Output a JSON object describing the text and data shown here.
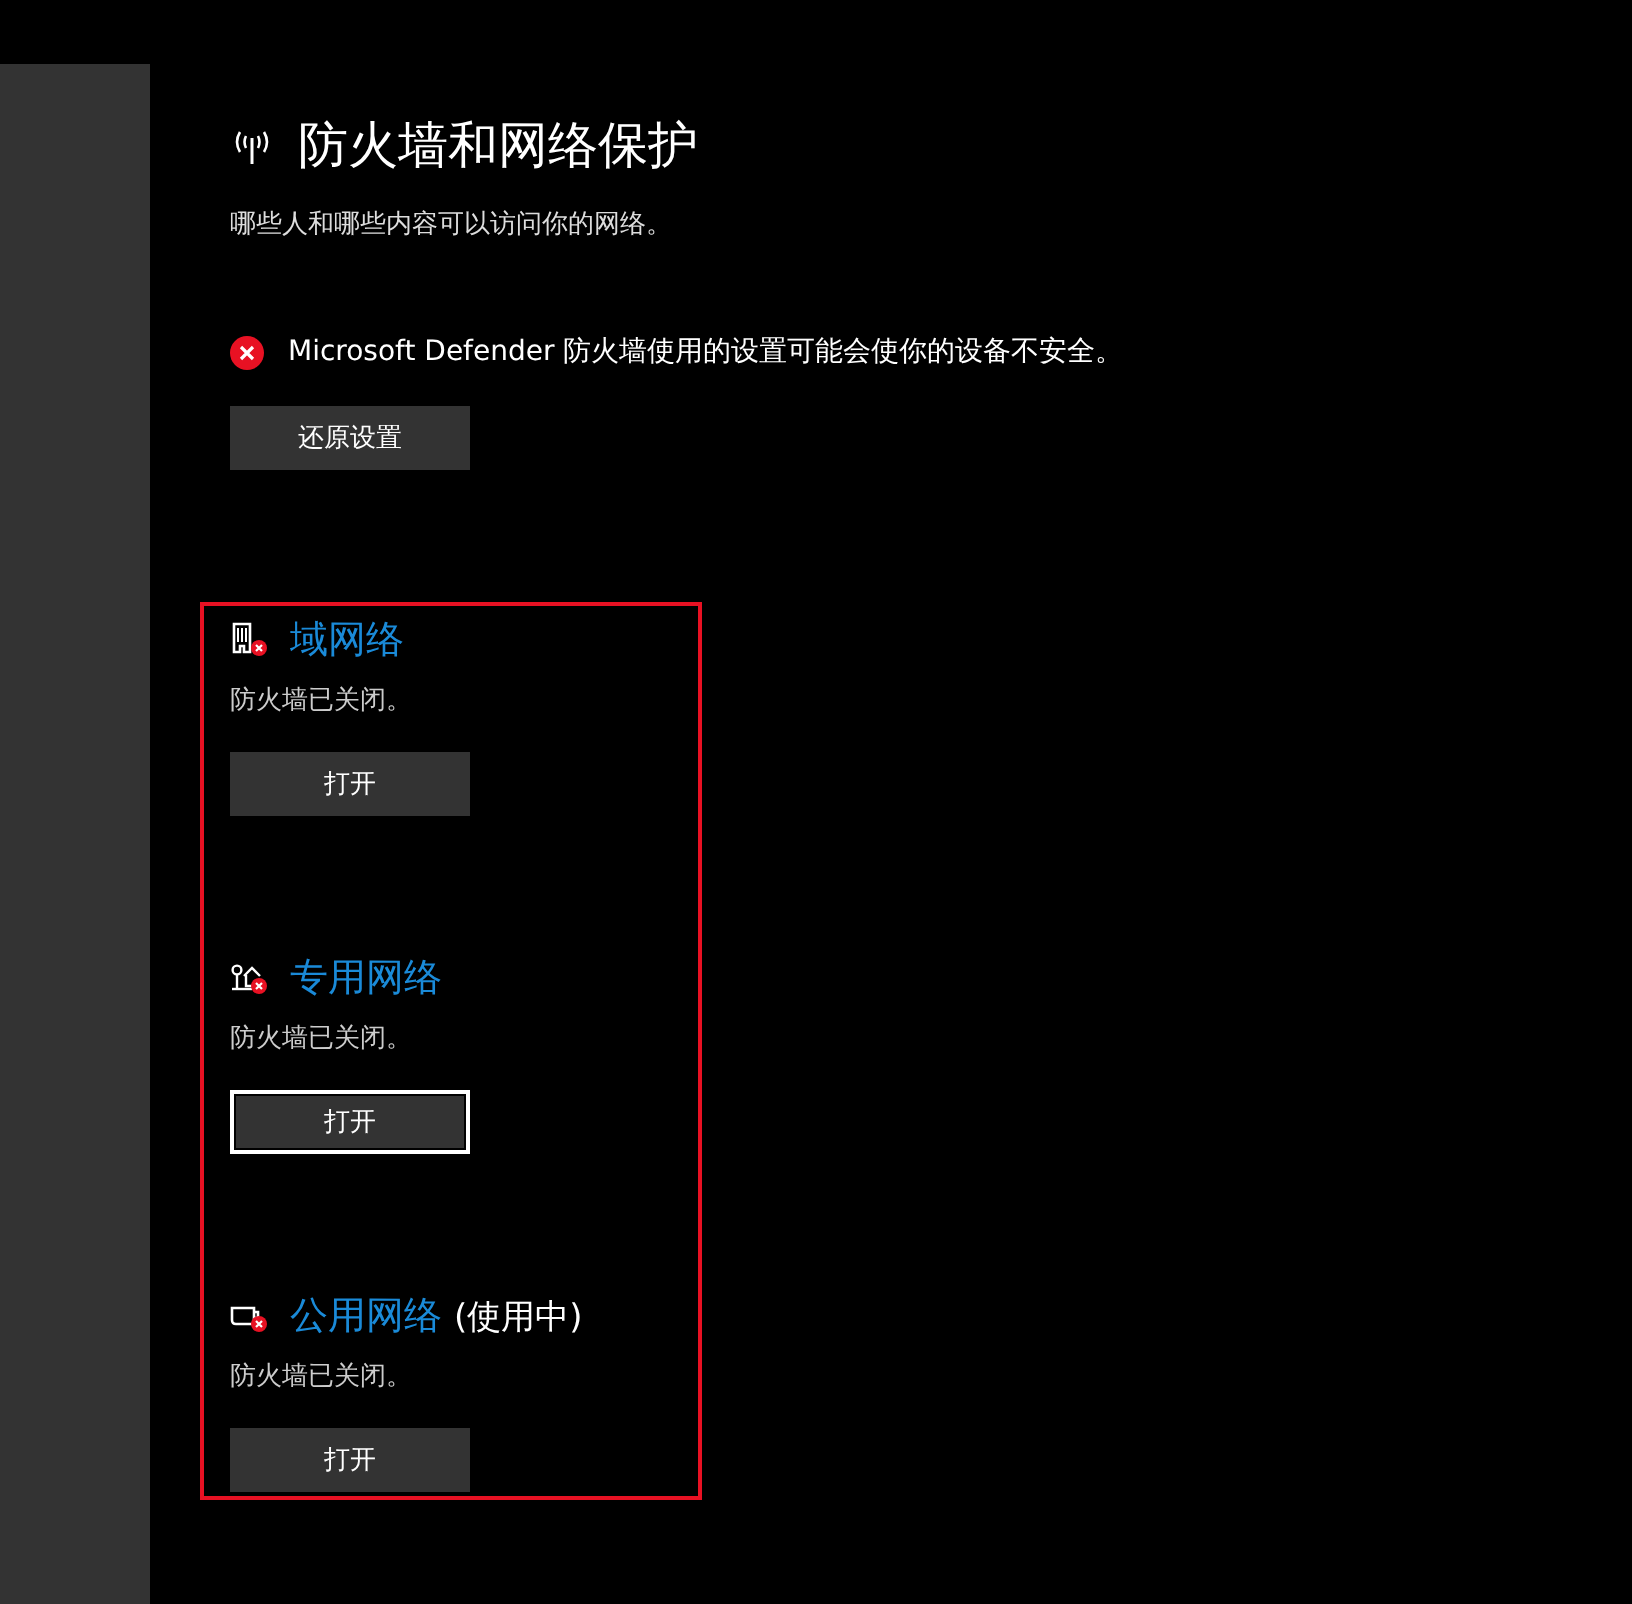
{
  "page": {
    "title": "防火墙和网络保护",
    "subtitle": "哪些人和哪些内容可以访问你的网络。"
  },
  "alert": {
    "message": "Microsoft Defender 防火墙使用的设置可能会使你的设备不安全。",
    "button": "还原设置"
  },
  "networks": [
    {
      "kind": "domain",
      "name": "域网络",
      "status": "防火墙已关闭。",
      "button": "打开",
      "focused": false
    },
    {
      "kind": "private",
      "name": "专用网络",
      "status": "防火墙已关闭。",
      "button": "打开",
      "focused": true
    },
    {
      "kind": "public",
      "name": "公用网络",
      "suffix": "(使用中)",
      "status": "防火墙已关闭。",
      "button": "打开",
      "focused": false
    }
  ]
}
